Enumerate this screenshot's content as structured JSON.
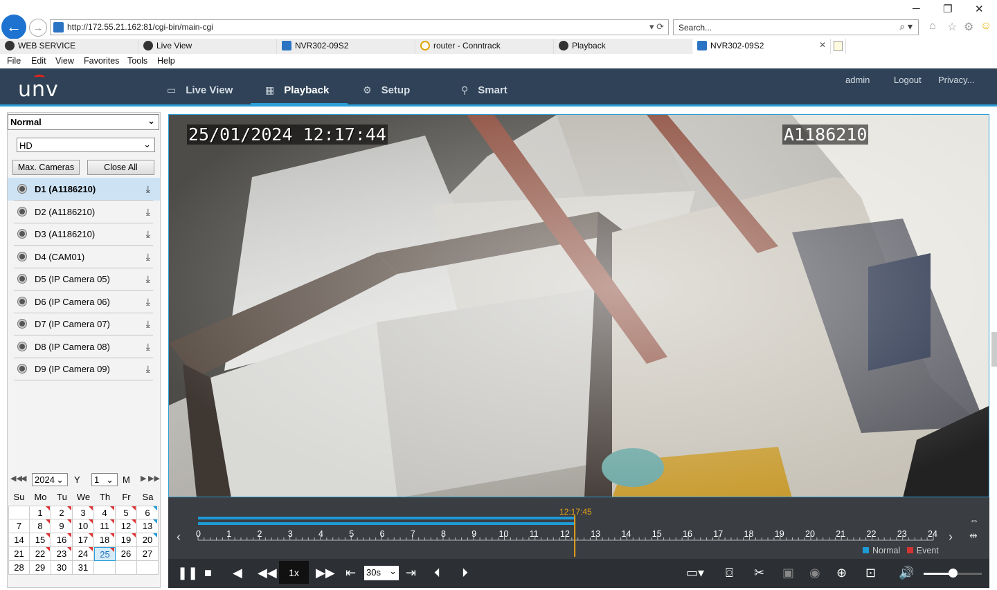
{
  "browser": {
    "address": "http://172.55.21.162:81/cgi-bin/main-cgi",
    "search_placeholder": "Search...",
    "tabs": [
      {
        "label": "WEB SERVICE"
      },
      {
        "label": "Live View"
      },
      {
        "label": "NVR302-09S2"
      },
      {
        "label": "router - Conntrack"
      },
      {
        "label": "Playback"
      },
      {
        "label": "NVR302-09S2"
      }
    ],
    "menu": [
      "File",
      "Edit",
      "View",
      "Favorites",
      "Tools",
      "Help"
    ]
  },
  "app": {
    "logo": "unv",
    "nav": [
      {
        "label": "Live View",
        "icon": "monitor-icon"
      },
      {
        "label": "Playback",
        "icon": "film-icon"
      },
      {
        "label": "Setup",
        "icon": "gear-icon"
      },
      {
        "label": "Smart",
        "icon": "person-icon"
      }
    ],
    "header_links": [
      "admin",
      "Logout",
      "Privacy..."
    ],
    "accent": "#2a9fd8",
    "header_bg": "#2f4257"
  },
  "left": {
    "mode_select": "Normal",
    "stream_select": "HD",
    "max_cameras": "Max. Cameras",
    "close_all": "Close All",
    "cameras": [
      "D1 (A1186210)",
      "D2 (A1186210)",
      "D3 (A1186210)",
      "D4 (CAM01)",
      "D5 (IP Camera 05)",
      "D6 (IP Camera 06)",
      "D7 (IP Camera 07)",
      "D8 (IP Camera 08)",
      "D9 (IP Camera 09)"
    ],
    "selected_camera": 0
  },
  "calendar": {
    "year": "2024",
    "year_label": "Y",
    "month": "1",
    "month_label": "M",
    "weekdays": [
      "Su",
      "Mo",
      "Tu",
      "We",
      "Th",
      "Fr",
      "Sa"
    ],
    "weeks": [
      [
        "",
        "1",
        "2",
        "3",
        "4",
        "5",
        "6"
      ],
      [
        "7",
        "8",
        "9",
        "10",
        "11",
        "12",
        "13"
      ],
      [
        "14",
        "15",
        "16",
        "17",
        "18",
        "19",
        "20"
      ],
      [
        "21",
        "22",
        "23",
        "24",
        "25",
        "26",
        "27"
      ],
      [
        "28",
        "29",
        "30",
        "31",
        "",
        "",
        ""
      ]
    ],
    "selected_day": "25"
  },
  "video": {
    "osd_time": "25/01/2024 12:17:44",
    "osd_camera": "A1186210"
  },
  "timeline": {
    "cursor_time": "12:17:45",
    "hours": [
      "0",
      "1",
      "2",
      "3",
      "4",
      "5",
      "6",
      "7",
      "8",
      "9",
      "10",
      "11",
      "12",
      "13",
      "14",
      "15",
      "16",
      "17",
      "18",
      "19",
      "20",
      "21",
      "22",
      "23",
      "24"
    ],
    "recorded_until_hour": 12.3,
    "legend_normal": "Normal",
    "legend_event": "Event",
    "normal_color": "#1e9ad6",
    "event_color": "#d33333"
  },
  "controls": {
    "speed": "1x",
    "step": "30s",
    "volume": 0.5
  }
}
